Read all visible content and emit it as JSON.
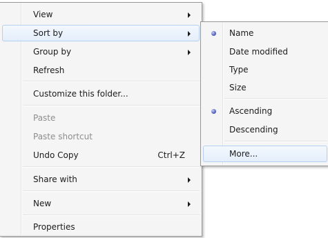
{
  "context_menu": {
    "items": [
      {
        "label": "View"
      },
      {
        "label": "Sort by"
      },
      {
        "label": "Group by"
      },
      {
        "label": "Refresh"
      },
      {
        "label": "Customize this folder..."
      },
      {
        "label": "Paste"
      },
      {
        "label": "Paste shortcut"
      },
      {
        "label": "Undo Copy",
        "shortcut": "Ctrl+Z"
      },
      {
        "label": "Share with"
      },
      {
        "label": "New"
      },
      {
        "label": "Properties"
      }
    ]
  },
  "sort_submenu": {
    "items": [
      {
        "label": "Name",
        "checked": true
      },
      {
        "label": "Date modified",
        "checked": false
      },
      {
        "label": "Type",
        "checked": false
      },
      {
        "label": "Size",
        "checked": false
      },
      {
        "label": "Ascending",
        "checked": true
      },
      {
        "label": "Descending",
        "checked": false
      },
      {
        "label": "More..."
      }
    ]
  },
  "colors": {
    "highlight_border": "#b4cff0",
    "highlight_fill": "#e4eefb",
    "disabled_text": "#8d8d8d",
    "radio_bullet": "#3c47a8"
  },
  "icons": [
    "submenu-arrow-icon",
    "radio-bullet-icon"
  ]
}
